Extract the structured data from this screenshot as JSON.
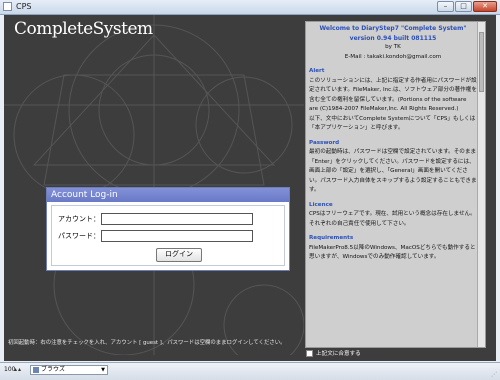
{
  "window": {
    "title": "CPS",
    "buttons": {
      "minimize": "–",
      "maximize": "□",
      "close": "✕"
    }
  },
  "app": {
    "brand": "CompleteSystem"
  },
  "login": {
    "title": "Account Log-in",
    "account_label": "アカウント：",
    "password_label": "パスワード：",
    "account_value": "",
    "password_value": "",
    "button": "ログイン"
  },
  "hint": "初回起動時：右の注意をチェックを入れ、アカウント [ guest ]、パスワードは空欄のままログインしてください。",
  "info": {
    "welcome_line1": "Welcome to DiaryStep7 \"Complete System\"",
    "welcome_line2": "version 0.94 built 081115",
    "by": "by TK",
    "email": "E-Mail : takaki.kondoh@gmail.com",
    "alert_title": "Alert",
    "alert_text": "このソリューションには、上記に指定する作者用にパスワードが設定されています。FileMaker, Inc.は、ソフトウェア部分の著作権を含む全ての権利を留保しています。(Portions of the software are (C)1984-2007 FileMaker,Inc. All Rights Reserved.)",
    "alert_text2": "以下、文中においてComplete Systemについて「CPS」もしくは「本アプリケーション」と呼びます。",
    "password_title": "Password",
    "password_text": "最初の起動時は、パスワードは空欄で設定されています。そのまま「Enter」をクリックしてください。パスワードを設定するには、画面上部の「設定」を選択し、「General」画面を開いてください。パスワード入力自体をスキップするよう設定することもできます。",
    "licence_title": "Licence",
    "licence_text": "CPSはフリーウェアです。現在、試用という概念は存在しません。それぞれの自己責任で使用して下さい。",
    "requirements_title": "Requirements",
    "requirements_text": "FileMakerPro8.5以降のWindows、MacOSどちらでも動作すると思いますが、Windowsでのみ動作確認しています。"
  },
  "hide_label": "上記文に合意する",
  "status": {
    "zoom": "100",
    "mode": "ブラウズ"
  },
  "colors": {
    "panel_bg": "#3d3d3d",
    "accent": "#2b4fb5",
    "dialog_header": "#7483cf"
  }
}
